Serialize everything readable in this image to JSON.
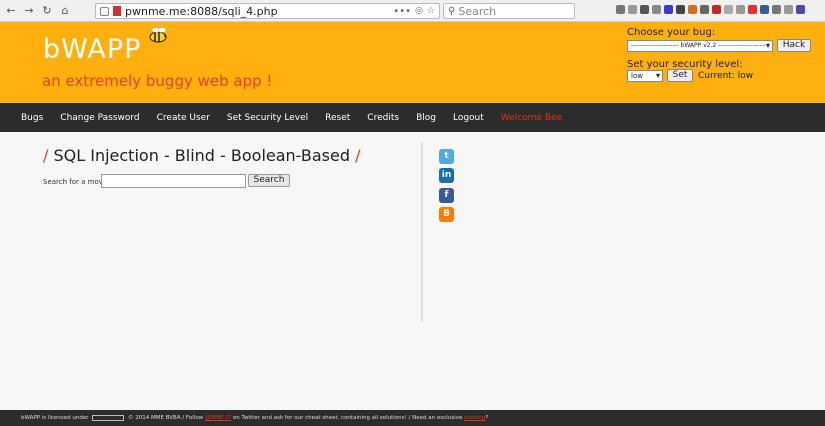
{
  "browser": {
    "url": "pwnme.me:8088/sqli_4.php",
    "search_placeholder": "Search"
  },
  "header": {
    "logo": "bWAPP",
    "tagline": "an extremely buggy web app !",
    "choose_bug_label": "Choose your bug:",
    "bug_select_value": "---------------------- bWAPP v2.2 ----------------------",
    "hack_button": "Hack",
    "security_level_label": "Set your security level:",
    "security_level_value": "low",
    "set_button": "Set",
    "current_level": "Current: low"
  },
  "menu": {
    "items": [
      "Bugs",
      "Change Password",
      "Create User",
      "Set Security Level",
      "Reset",
      "Credits",
      "Blog",
      "Logout"
    ],
    "welcome": "Welcome Bee"
  },
  "main": {
    "title": "SQL Injection - Blind - Boolean-Based",
    "search_label": "Search for a movie:",
    "search_button": "Search",
    "search_value": ""
  },
  "footer": {
    "part1": "bWAPP is licensed under",
    "part2": "© 2014 MME BVBA / Follow",
    "handle": "@MME_IT",
    "part3": "on Twitter and ask for our cheat sheet, containing all solutions! / Need an exclusive",
    "training": "training",
    "part4": "?"
  },
  "colors": {
    "header_bg": "#ffb00f",
    "accent": "#e8411a",
    "menu_bg": "#2c2c2c"
  }
}
